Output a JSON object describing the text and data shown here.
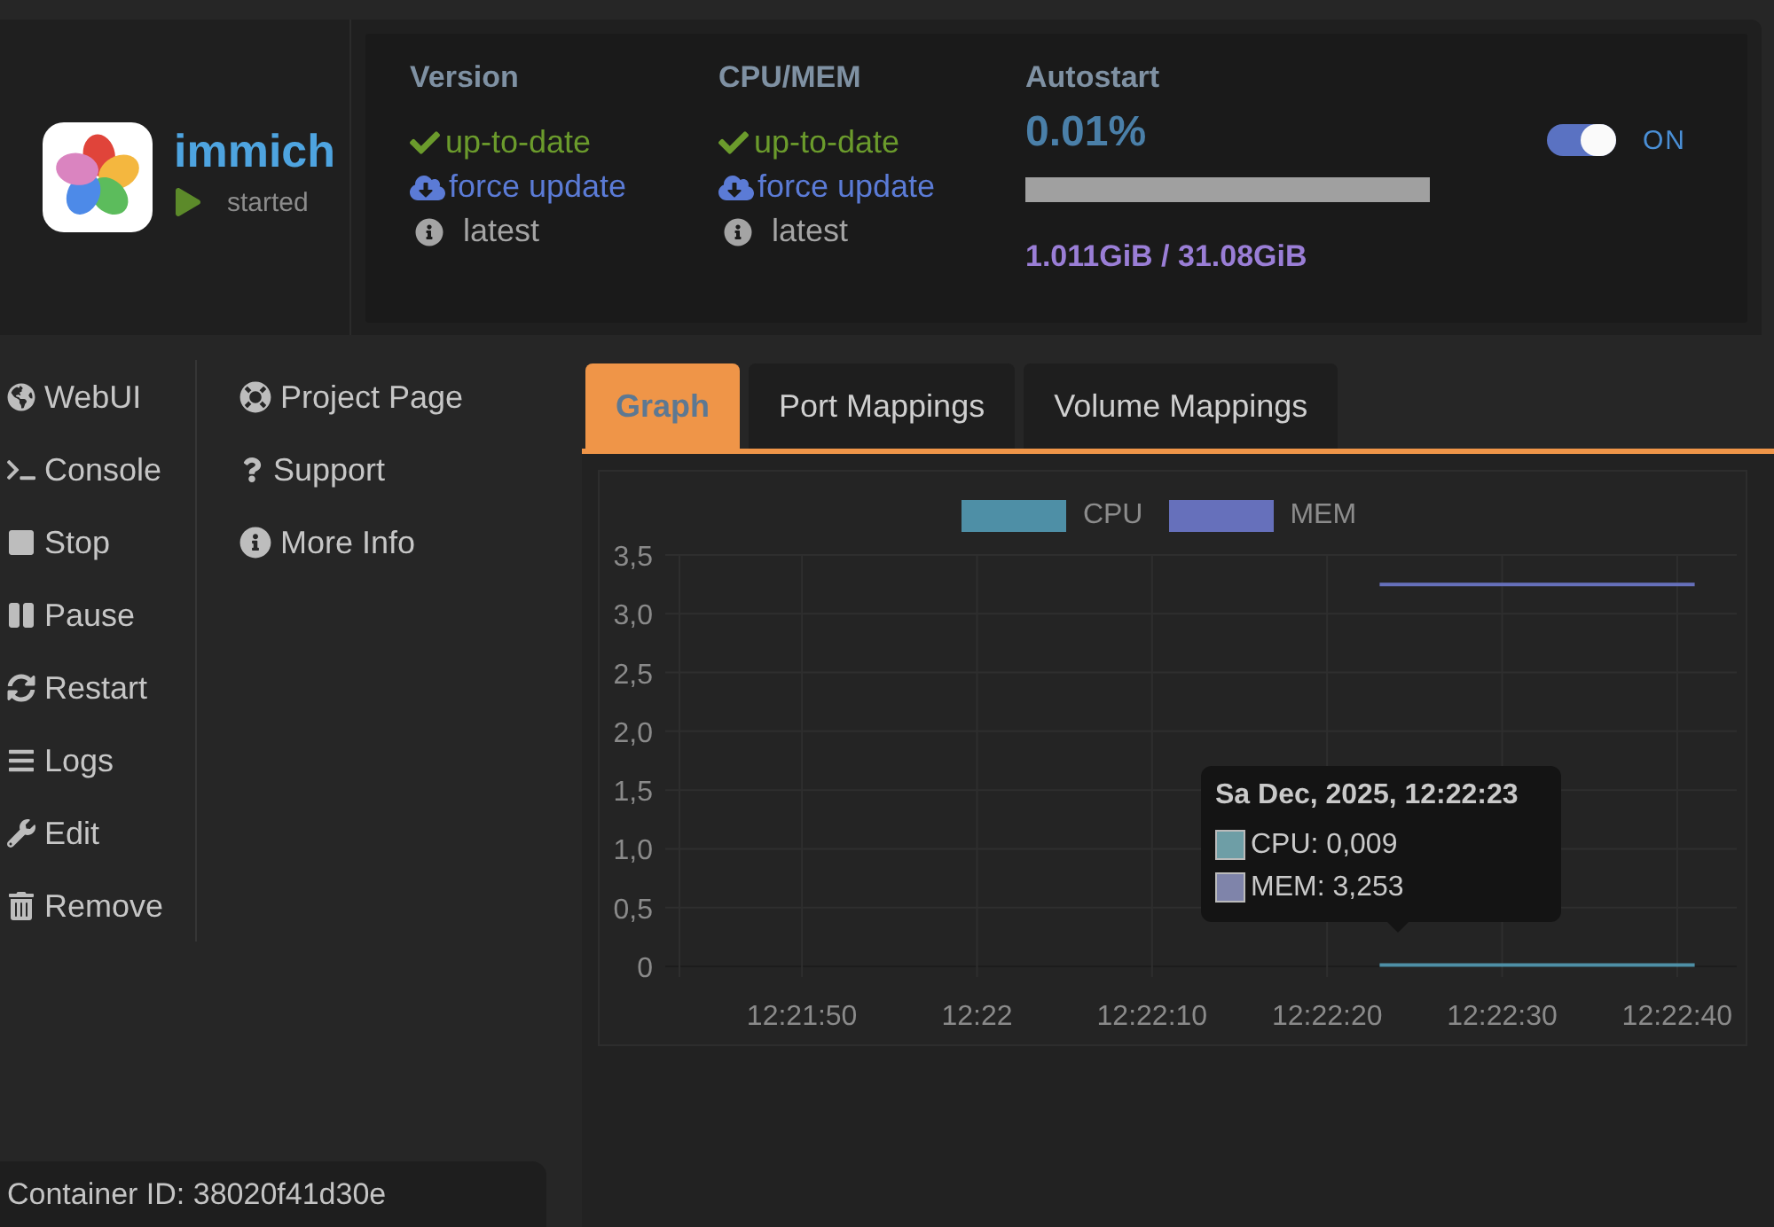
{
  "header": {
    "app": {
      "name": "immich",
      "status": {
        "label": "started",
        "kind": "running"
      }
    },
    "columns": [
      {
        "heading": "Version",
        "items": [
          {
            "kind": "status",
            "text": "up-to-date"
          },
          {
            "kind": "action",
            "text": "force update"
          },
          {
            "kind": "note",
            "text": "latest"
          }
        ]
      },
      {
        "heading": "CPU/MEM",
        "items": [
          {
            "kind": "status",
            "text": "up-to-date"
          },
          {
            "kind": "action",
            "text": "force update"
          },
          {
            "kind": "note",
            "text": "latest"
          }
        ]
      }
    ],
    "usage": {
      "heading": "Autostart",
      "cpu": "0.01%",
      "level": 0.0001,
      "memory": "1.011GiB / 31.08GiB"
    },
    "autostart": {
      "on": true,
      "label": "ON"
    }
  },
  "menu": {
    "actions": [
      "WebUI",
      "Console",
      "Stop",
      "Pause",
      "Restart",
      "Logs",
      "Edit",
      "Remove"
    ],
    "links": [
      "Project Page",
      "Support",
      "More Info"
    ]
  },
  "container": {
    "label": "Container ID: 38020f41d30e"
  },
  "tabs": [
    {
      "label": "Graph",
      "selected": true
    },
    {
      "label": "Port Mappings",
      "selected": false
    },
    {
      "label": "Volume Mappings",
      "selected": false
    }
  ],
  "graph": {
    "chart_data": {
      "type": "line",
      "grid": true,
      "legend": "top",
      "categories": [
        null,
        null,
        null,
        null,
        null,
        null,
        null,
        "12:21:50",
        null,
        null,
        null,
        null,
        null,
        null,
        null,
        null,
        null,
        "12:22",
        null,
        null,
        null,
        null,
        null,
        null,
        null,
        null,
        null,
        "12:22:10",
        null,
        null,
        null,
        null,
        null,
        null,
        null,
        null,
        null,
        "12:22:20",
        null,
        null,
        null,
        null,
        null,
        null,
        null,
        null,
        null,
        "12:22:30",
        null,
        null,
        null,
        null,
        null,
        null,
        null,
        null,
        null,
        "12:22:40",
        null,
        null,
        null
      ],
      "series": [
        {
          "name": "CPU",
          "color": "#4e8fa6",
          "values": [
            null,
            null,
            null,
            null,
            null,
            null,
            null,
            null,
            null,
            null,
            null,
            null,
            null,
            null,
            null,
            null,
            null,
            null,
            null,
            null,
            null,
            null,
            null,
            null,
            null,
            null,
            null,
            null,
            null,
            null,
            null,
            null,
            null,
            null,
            null,
            null,
            null,
            null,
            null,
            null,
            0.01,
            0.01,
            0.01,
            0.01,
            0.01,
            0.01,
            0.01,
            0.01,
            0.01,
            0.01,
            0.01,
            0.01,
            0.01,
            0.01,
            0.01,
            0.01,
            0.01,
            0.01,
            0.01,
            null,
            null
          ]
        },
        {
          "name": "MEM",
          "color": "#6670bb",
          "values": [
            null,
            null,
            null,
            null,
            null,
            null,
            null,
            null,
            null,
            null,
            null,
            null,
            null,
            null,
            null,
            null,
            null,
            null,
            null,
            null,
            null,
            null,
            null,
            null,
            null,
            null,
            null,
            null,
            null,
            null,
            null,
            null,
            null,
            null,
            null,
            null,
            null,
            null,
            null,
            null,
            3.25,
            3.25,
            3.25,
            3.25,
            3.25,
            3.25,
            3.25,
            3.25,
            3.25,
            3.25,
            3.25,
            3.25,
            3.25,
            3.25,
            3.25,
            3.25,
            3.25,
            3.25,
            3.25,
            null,
            null
          ]
        }
      ],
      "ylim": [
        0,
        3.5
      ],
      "yticks": [
        {
          "value": 0,
          "label": "0"
        },
        {
          "value": 0.5,
          "label": "0,5"
        },
        {
          "value": 1,
          "label": "1,0"
        },
        {
          "value": 1.5,
          "label": "1,5"
        },
        {
          "value": 2,
          "label": "2,0"
        },
        {
          "value": 2.5,
          "label": "2,5"
        },
        {
          "value": 3,
          "label": "3,0"
        },
        {
          "value": 3.5,
          "label": "3,5"
        }
      ]
    },
    "tooltip": {
      "title": "Sa Dec, 2025, 12:22:23",
      "items": [
        {
          "label": "CPU: 0,009",
          "color": "#6e9ea6"
        },
        {
          "label": "MEM: 3,253",
          "color": "#7f84aa"
        }
      ]
    }
  }
}
